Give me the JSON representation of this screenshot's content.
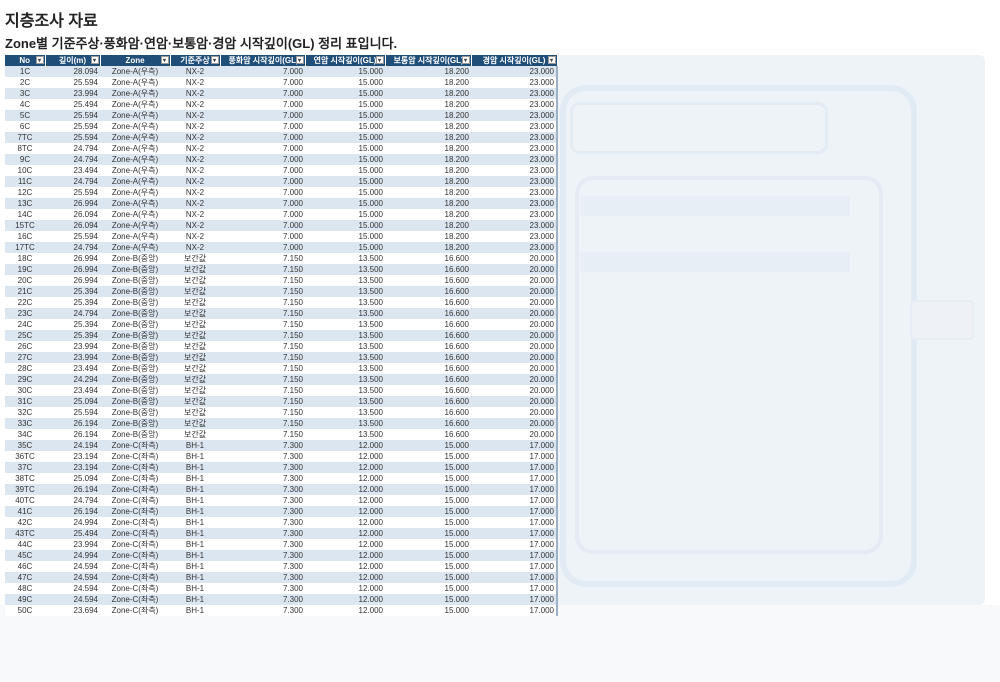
{
  "title": "지층조사 자료",
  "subtitle": "Zone별 기준주상·풍화암·연암·보통암·경암 시작깊이(GL) 정리 표입니다.",
  "columns": [
    "No",
    "깊이(m)",
    "Zone",
    "기준주상",
    "풍화암 시작깊이(GL)",
    "연암 시작깊이(GL)",
    "보통암 시작깊이(GL)",
    "경암 시작깊이(GL)"
  ],
  "dropdown_glyph": "▾",
  "rows": [
    [
      "1C",
      "28.094",
      "Zone-A(우측)",
      "NX-2",
      "7.000",
      "15.000",
      "18.200",
      "23.000"
    ],
    [
      "2C",
      "25.594",
      "Zone-A(우측)",
      "NX-2",
      "7.000",
      "15.000",
      "18.200",
      "23.000"
    ],
    [
      "3C",
      "23.994",
      "Zone-A(우측)",
      "NX-2",
      "7.000",
      "15.000",
      "18.200",
      "23.000"
    ],
    [
      "4C",
      "25.494",
      "Zone-A(우측)",
      "NX-2",
      "7.000",
      "15.000",
      "18.200",
      "23.000"
    ],
    [
      "5C",
      "25.594",
      "Zone-A(우측)",
      "NX-2",
      "7.000",
      "15.000",
      "18.200",
      "23.000"
    ],
    [
      "6C",
      "25.594",
      "Zone-A(우측)",
      "NX-2",
      "7.000",
      "15.000",
      "18.200",
      "23.000"
    ],
    [
      "7TC",
      "25.594",
      "Zone-A(우측)",
      "NX-2",
      "7.000",
      "15.000",
      "18.200",
      "23.000"
    ],
    [
      "8TC",
      "24.794",
      "Zone-A(우측)",
      "NX-2",
      "7.000",
      "15.000",
      "18.200",
      "23.000"
    ],
    [
      "9C",
      "24.794",
      "Zone-A(우측)",
      "NX-2",
      "7.000",
      "15.000",
      "18.200",
      "23.000"
    ],
    [
      "10C",
      "23.494",
      "Zone-A(우측)",
      "NX-2",
      "7.000",
      "15.000",
      "18.200",
      "23.000"
    ],
    [
      "11C",
      "24.794",
      "Zone-A(우측)",
      "NX-2",
      "7.000",
      "15.000",
      "18.200",
      "23.000"
    ],
    [
      "12C",
      "25.594",
      "Zone-A(우측)",
      "NX-2",
      "7.000",
      "15.000",
      "18.200",
      "23.000"
    ],
    [
      "13C",
      "26.994",
      "Zone-A(우측)",
      "NX-2",
      "7.000",
      "15.000",
      "18.200",
      "23.000"
    ],
    [
      "14C",
      "26.094",
      "Zone-A(우측)",
      "NX-2",
      "7.000",
      "15.000",
      "18.200",
      "23.000"
    ],
    [
      "15TC",
      "26.094",
      "Zone-A(우측)",
      "NX-2",
      "7.000",
      "15.000",
      "18.200",
      "23.000"
    ],
    [
      "16C",
      "25.594",
      "Zone-A(우측)",
      "NX-2",
      "7.000",
      "15.000",
      "18.200",
      "23.000"
    ],
    [
      "17TC",
      "24.794",
      "Zone-A(우측)",
      "NX-2",
      "7.000",
      "15.000",
      "18.200",
      "23.000"
    ],
    [
      "18C",
      "26.994",
      "Zone-B(중앙)",
      "보간값",
      "7.150",
      "13.500",
      "16.600",
      "20.000"
    ],
    [
      "19C",
      "26.994",
      "Zone-B(중앙)",
      "보간값",
      "7.150",
      "13.500",
      "16.600",
      "20.000"
    ],
    [
      "20C",
      "26.994",
      "Zone-B(중앙)",
      "보간값",
      "7.150",
      "13.500",
      "16.600",
      "20.000"
    ],
    [
      "21C",
      "25.394",
      "Zone-B(중앙)",
      "보간값",
      "7.150",
      "13.500",
      "16.600",
      "20.000"
    ],
    [
      "22C",
      "25.394",
      "Zone-B(중앙)",
      "보간값",
      "7.150",
      "13.500",
      "16.600",
      "20.000"
    ],
    [
      "23C",
      "24.794",
      "Zone-B(중앙)",
      "보간값",
      "7.150",
      "13.500",
      "16.600",
      "20.000"
    ],
    [
      "24C",
      "25.394",
      "Zone-B(중앙)",
      "보간값",
      "7.150",
      "13.500",
      "16.600",
      "20.000"
    ],
    [
      "25C",
      "25.394",
      "Zone-B(중앙)",
      "보간값",
      "7.150",
      "13.500",
      "16.600",
      "20.000"
    ],
    [
      "26C",
      "23.994",
      "Zone-B(중앙)",
      "보간값",
      "7.150",
      "13.500",
      "16.600",
      "20.000"
    ],
    [
      "27C",
      "23.994",
      "Zone-B(중앙)",
      "보간값",
      "7.150",
      "13.500",
      "16.600",
      "20.000"
    ],
    [
      "28C",
      "23.494",
      "Zone-B(중앙)",
      "보간값",
      "7.150",
      "13.500",
      "16.600",
      "20.000"
    ],
    [
      "29C",
      "24.294",
      "Zone-B(중앙)",
      "보간값",
      "7.150",
      "13.500",
      "16.600",
      "20.000"
    ],
    [
      "30C",
      "23.494",
      "Zone-B(중앙)",
      "보간값",
      "7.150",
      "13.500",
      "16.600",
      "20.000"
    ],
    [
      "31C",
      "25.094",
      "Zone-B(중앙)",
      "보간값",
      "7.150",
      "13.500",
      "16.600",
      "20.000"
    ],
    [
      "32C",
      "25.594",
      "Zone-B(중앙)",
      "보간값",
      "7.150",
      "13.500",
      "16.600",
      "20.000"
    ],
    [
      "33C",
      "26.194",
      "Zone-B(중앙)",
      "보간값",
      "7.150",
      "13.500",
      "16.600",
      "20.000"
    ],
    [
      "34C",
      "26.194",
      "Zone-B(중앙)",
      "보간값",
      "7.150",
      "13.500",
      "16.600",
      "20.000"
    ],
    [
      "35C",
      "24.194",
      "Zone-C(좌측)",
      "BH-1",
      "7.300",
      "12.000",
      "15.000",
      "17.000"
    ],
    [
      "36TC",
      "23.194",
      "Zone-C(좌측)",
      "BH-1",
      "7.300",
      "12.000",
      "15.000",
      "17.000"
    ],
    [
      "37C",
      "23.194",
      "Zone-C(좌측)",
      "BH-1",
      "7.300",
      "12.000",
      "15.000",
      "17.000"
    ],
    [
      "38TC",
      "25.094",
      "Zone-C(좌측)",
      "BH-1",
      "7.300",
      "12.000",
      "15.000",
      "17.000"
    ],
    [
      "39TC",
      "26.194",
      "Zone-C(좌측)",
      "BH-1",
      "7.300",
      "12.000",
      "15.000",
      "17.000"
    ],
    [
      "40TC",
      "24.794",
      "Zone-C(좌측)",
      "BH-1",
      "7.300",
      "12.000",
      "15.000",
      "17.000"
    ],
    [
      "41C",
      "26.194",
      "Zone-C(좌측)",
      "BH-1",
      "7.300",
      "12.000",
      "15.000",
      "17.000"
    ],
    [
      "42C",
      "24.994",
      "Zone-C(좌측)",
      "BH-1",
      "7.300",
      "12.000",
      "15.000",
      "17.000"
    ],
    [
      "43TC",
      "25.494",
      "Zone-C(좌측)",
      "BH-1",
      "7.300",
      "12.000",
      "15.000",
      "17.000"
    ],
    [
      "44C",
      "23.994",
      "Zone-C(좌측)",
      "BH-1",
      "7.300",
      "12.000",
      "15.000",
      "17.000"
    ],
    [
      "45C",
      "24.994",
      "Zone-C(좌측)",
      "BH-1",
      "7.300",
      "12.000",
      "15.000",
      "17.000"
    ],
    [
      "46C",
      "24.594",
      "Zone-C(좌측)",
      "BH-1",
      "7.300",
      "12.000",
      "15.000",
      "17.000"
    ],
    [
      "47C",
      "24.594",
      "Zone-C(좌측)",
      "BH-1",
      "7.300",
      "12.000",
      "15.000",
      "17.000"
    ],
    [
      "48C",
      "24.594",
      "Zone-C(좌측)",
      "BH-1",
      "7.300",
      "12.000",
      "15.000",
      "17.000"
    ],
    [
      "49C",
      "24.594",
      "Zone-C(좌측)",
      "BH-1",
      "7.300",
      "12.000",
      "15.000",
      "17.000"
    ],
    [
      "50C",
      "23.694",
      "Zone-C(좌측)",
      "BH-1",
      "7.300",
      "12.000",
      "15.000",
      "17.000"
    ]
  ],
  "colors": {
    "header_bg": "#1f4e79",
    "band": "#dce6f1"
  }
}
